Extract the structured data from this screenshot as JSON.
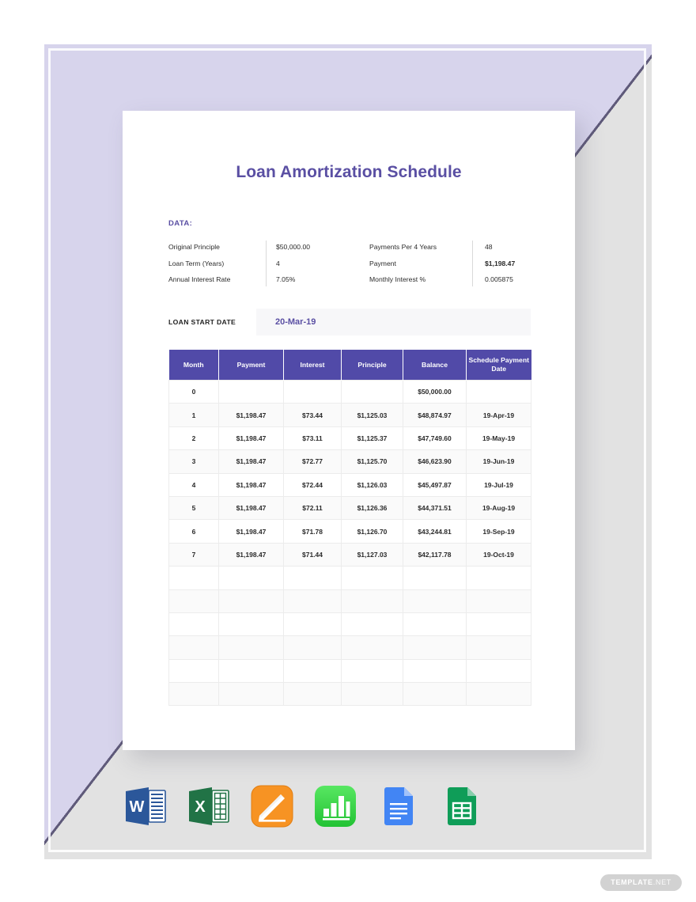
{
  "document": {
    "title": "Loan Amortization Schedule",
    "data_section_label": "DATA:",
    "data_fields": [
      {
        "key1": "Original Principle",
        "val1": "$50,000.00",
        "key2": "Payments Per 4 Years",
        "val2": "48",
        "val2_bold": false
      },
      {
        "key1": "Loan Term (Years)",
        "val1": "4",
        "key2": "Payment",
        "val2": "$1,198.47",
        "val2_bold": true
      },
      {
        "key1": "Annual Interest Rate",
        "val1": "7.05%",
        "key2": "Monthly Interest %",
        "val2": "0.005875",
        "val2_bold": false
      }
    ],
    "start_date": {
      "label": "LOAN START DATE",
      "value": "20-Mar-19"
    },
    "table": {
      "columns": [
        "Month",
        "Payment",
        "Interest",
        "Principle",
        "Balance",
        "Schedule Payment Date"
      ],
      "rows": [
        [
          "0",
          "",
          "",
          "",
          "$50,000.00",
          ""
        ],
        [
          "1",
          "$1,198.47",
          "$73.44",
          "$1,125.03",
          "$48,874.97",
          "19-Apr-19"
        ],
        [
          "2",
          "$1,198.47",
          "$73.11",
          "$1,125.37",
          "$47,749.60",
          "19-May-19"
        ],
        [
          "3",
          "$1,198.47",
          "$72.77",
          "$1,125.70",
          "$46,623.90",
          "19-Jun-19"
        ],
        [
          "4",
          "$1,198.47",
          "$72.44",
          "$1,126.03",
          "$45,497.87",
          "19-Jul-19"
        ],
        [
          "5",
          "$1,198.47",
          "$72.11",
          "$1,126.36",
          "$44,371.51",
          "19-Aug-19"
        ],
        [
          "6",
          "$1,198.47",
          "$71.78",
          "$1,126.70",
          "$43,244.81",
          "19-Sep-19"
        ],
        [
          "7",
          "$1,198.47",
          "$71.44",
          "$1,127.03",
          "$42,117.78",
          "19-Oct-19"
        ],
        [
          "",
          "",
          "",
          "",
          "",
          ""
        ],
        [
          "",
          "",
          "",
          "",
          "",
          ""
        ],
        [
          "",
          "",
          "",
          "",
          "",
          ""
        ],
        [
          "",
          "",
          "",
          "",
          "",
          ""
        ],
        [
          "",
          "",
          "",
          "",
          "",
          ""
        ],
        [
          "",
          "",
          "",
          "",
          "",
          ""
        ]
      ]
    }
  },
  "app_icons": [
    {
      "name": "microsoft-word-icon",
      "label": "Word"
    },
    {
      "name": "microsoft-excel-icon",
      "label": "Excel"
    },
    {
      "name": "apple-pages-icon",
      "label": "Pages"
    },
    {
      "name": "apple-numbers-icon",
      "label": "Numbers"
    },
    {
      "name": "google-docs-icon",
      "label": "Docs"
    },
    {
      "name": "google-sheets-icon",
      "label": "Sheets"
    }
  ],
  "brand": {
    "name": "TEMPLATE",
    "suffix": ".NET"
  },
  "colors": {
    "title_purple": "#5a4fa3",
    "header_purple": "#514aa8",
    "background_lavender": "#d7d4ec",
    "background_grey": "#e2e2e2",
    "row_stripe": "#fafafa",
    "badge_grey": "#d2d2d2"
  }
}
